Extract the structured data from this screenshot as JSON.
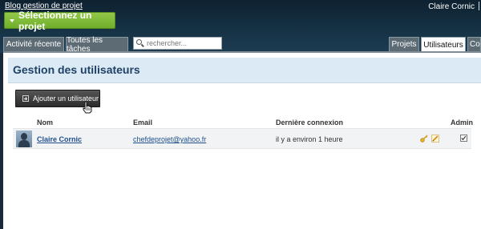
{
  "header": {
    "blog_link": "Blog gestion de projet",
    "user_name": "Claire Cornic",
    "project_select": "Sélectionnez un projet"
  },
  "nav": {
    "tabs_left": [
      "Activité récente",
      "Toutes les tâches"
    ],
    "search_placeholder": "rechercher...",
    "tabs_right": [
      "Projets",
      "Utilisateurs",
      "Co"
    ]
  },
  "page": {
    "title": "Gestion des utilisateurs",
    "add_button": "Ajouter un utilisateur"
  },
  "table": {
    "columns": [
      "Nom",
      "Email",
      "Dernière connexion",
      "Admin"
    ],
    "rows": [
      {
        "name": "Claire Cornic",
        "email": "chefdeprojet@yahoo.fr",
        "last_login": "il y a environ 1 heure",
        "admin": true
      }
    ]
  },
  "colors": {
    "accent_green": "#7bb733",
    "title_blue": "#1f4266",
    "link_blue": "#1f4e8c"
  },
  "icons": [
    "search-icon",
    "plus-icon",
    "avatar",
    "key-icon",
    "edit-icon",
    "checkbox-checked"
  ]
}
